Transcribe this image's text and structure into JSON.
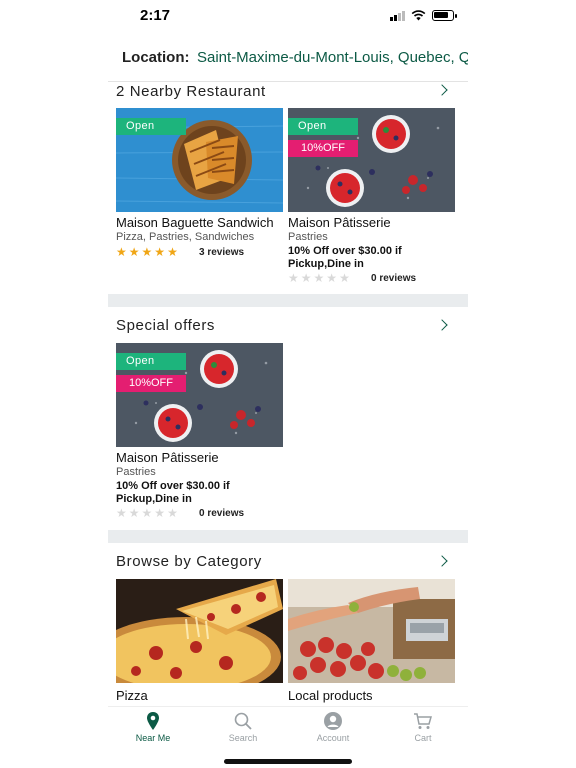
{
  "status_bar": {
    "time": "2:17"
  },
  "location": {
    "label": "Location:",
    "value": "Saint-Maxime-du-Mont-Louis, Quebec, Q"
  },
  "nearby": {
    "title": "2 Nearby Restaurant",
    "cards": [
      {
        "badge": "Open",
        "discount": "",
        "name": "Maison Baguette Sandwich",
        "categories": "Pizza, Pastries, Sandwiches",
        "offer": "",
        "rating": 5,
        "reviews": "3 reviews"
      },
      {
        "badge": "Open",
        "discount": "10%OFF",
        "name": "Maison Pâtisserie",
        "categories": "Pastries",
        "offer": "10% Off over $30.00 if Pickup,Dine in",
        "rating": 0,
        "reviews": "0 reviews"
      }
    ]
  },
  "special_offers": {
    "title": "Special offers",
    "cards": [
      {
        "badge": "Open",
        "discount": "10%OFF",
        "name": "Maison Pâtisserie",
        "categories": "Pastries",
        "offer": "10% Off over $30.00 if Pickup,Dine in",
        "rating": 0,
        "reviews": "0 reviews"
      }
    ]
  },
  "browse": {
    "title": "Browse by Category",
    "categories": [
      {
        "name": "Pizza"
      },
      {
        "name": "Local products"
      }
    ]
  },
  "tab_bar": {
    "tabs": [
      {
        "label": "Near Me",
        "icon": "map-pin-icon",
        "active": true
      },
      {
        "label": "Search",
        "icon": "search-icon",
        "active": false
      },
      {
        "label": "Account",
        "icon": "person-icon",
        "active": false
      },
      {
        "label": "Cart",
        "icon": "cart-icon",
        "active": false
      }
    ]
  },
  "colors": {
    "accent": "#0c5a45",
    "open": "#1db47c",
    "discount": "#e41e71",
    "star": "#f0a616",
    "divider": "#e9ecee"
  }
}
